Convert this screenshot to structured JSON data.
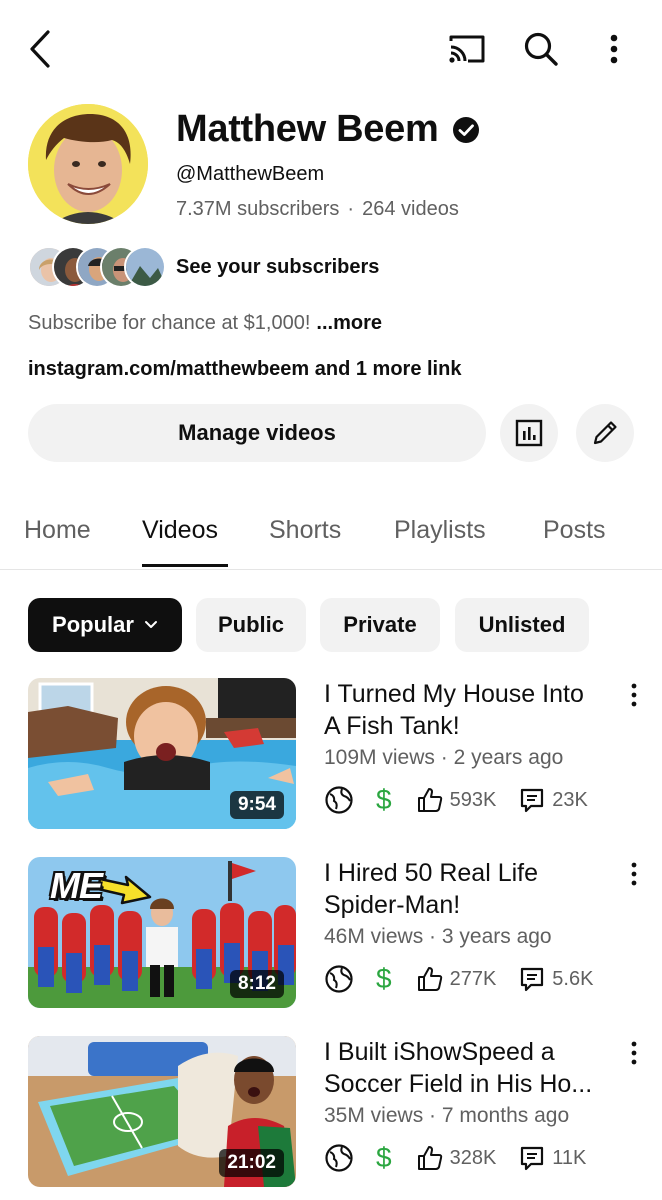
{
  "header": {
    "icons": [
      "back-arrow-icon",
      "cast-icon",
      "search-icon",
      "more-vert-icon"
    ]
  },
  "channel": {
    "name": "Matthew Beem",
    "handle": "@MatthewBeem",
    "subscribers": "7.37M subscribers",
    "videos": "264 videos",
    "separator": "·",
    "see_subscribers": "See your subscribers",
    "description": "Subscribe for chance at $1,000!",
    "more": "...more",
    "links": "instagram.com/matthewbeem and 1 more link",
    "manage_videos": "Manage videos"
  },
  "tabs": [
    {
      "label": "Home",
      "active": false
    },
    {
      "label": "Videos",
      "active": true
    },
    {
      "label": "Shorts",
      "active": false
    },
    {
      "label": "Playlists",
      "active": false
    },
    {
      "label": "Posts",
      "active": false
    }
  ],
  "chips": [
    {
      "label": "Popular",
      "selected": true
    },
    {
      "label": "Public",
      "selected": false
    },
    {
      "label": "Private",
      "selected": false
    },
    {
      "label": "Unlisted",
      "selected": false
    }
  ],
  "videos": [
    {
      "title_line1": "I Turned My House Into",
      "title_line2": "A Fish Tank!",
      "views": "109M views",
      "age": "2 years ago",
      "duration": "9:54",
      "likes": "593K",
      "comments": "23K"
    },
    {
      "title_line1": "I Hired 50 Real Life",
      "title_line2": "Spider-Man!",
      "views": "46M views",
      "age": "3 years ago",
      "duration": "8:12",
      "likes": "277K",
      "comments": "5.6K",
      "thumb_caption": "ME"
    },
    {
      "title_line1": "I Built iShowSpeed a",
      "title_line2": "Soccer Field in His Ho...",
      "views": "35M views",
      "age": "7 months ago",
      "duration": "21:02",
      "likes": "328K",
      "comments": "11K"
    }
  ],
  "colors": {
    "text": "#0f0f0f",
    "secondary": "#606060",
    "chip_bg": "#f2f2f2",
    "selected_chip": "#0f0f0f",
    "monetization": "#2ba640"
  }
}
